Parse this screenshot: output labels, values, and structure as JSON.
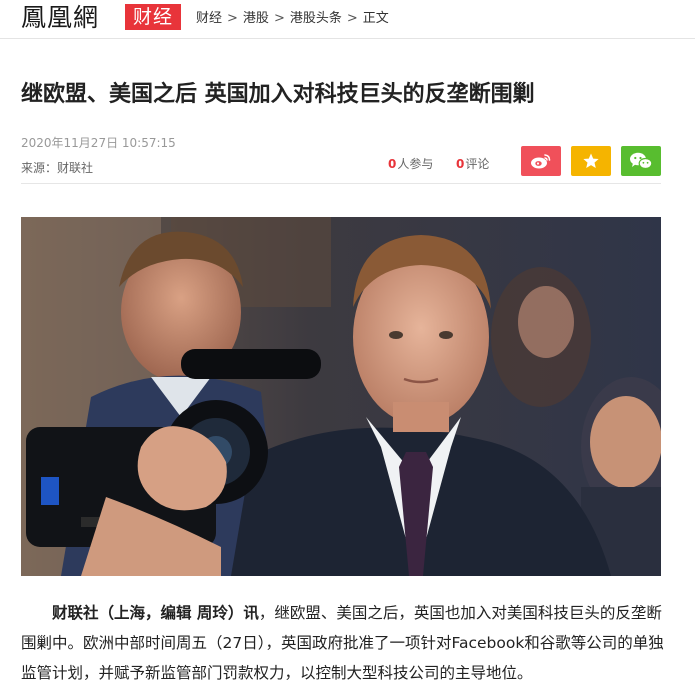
{
  "header": {
    "logo_text": "鳳凰網",
    "logo_badge": "财经",
    "breadcrumb": [
      "财经",
      "港股",
      "港股头条",
      "正文"
    ],
    "separator": ">"
  },
  "article": {
    "title": "继欧盟、美国之后 英国加入对科技巨头的反垄断围剿",
    "date": "2020年11月27日 10:57:15",
    "source_label": "来源：",
    "source_name": "财联社",
    "participants_count": "0",
    "participants_label": "人参与",
    "comments_count": "0",
    "comments_label": "评论",
    "lead": "财联社（上海，编辑 周玲）讯",
    "body": "，继欧盟、美国之后，英国也加入对美国科技巨头的反垄断围剿中。欧洲中部时间周五（27日），英国政府批准了一项针对Facebook和谷歌等公司的单独监管计划，并赋予新监管部门罚款权力，以控制大型科技公司的主导地位。"
  },
  "share": {
    "weibo_icon": "weibo-icon",
    "favorite_icon": "star-icon",
    "wechat_icon": "wechat-icon"
  },
  "colors": {
    "brand_red": "#e8343a",
    "weibo": "#f0505a",
    "favorite": "#f5b400",
    "wechat": "#58bd2f"
  }
}
